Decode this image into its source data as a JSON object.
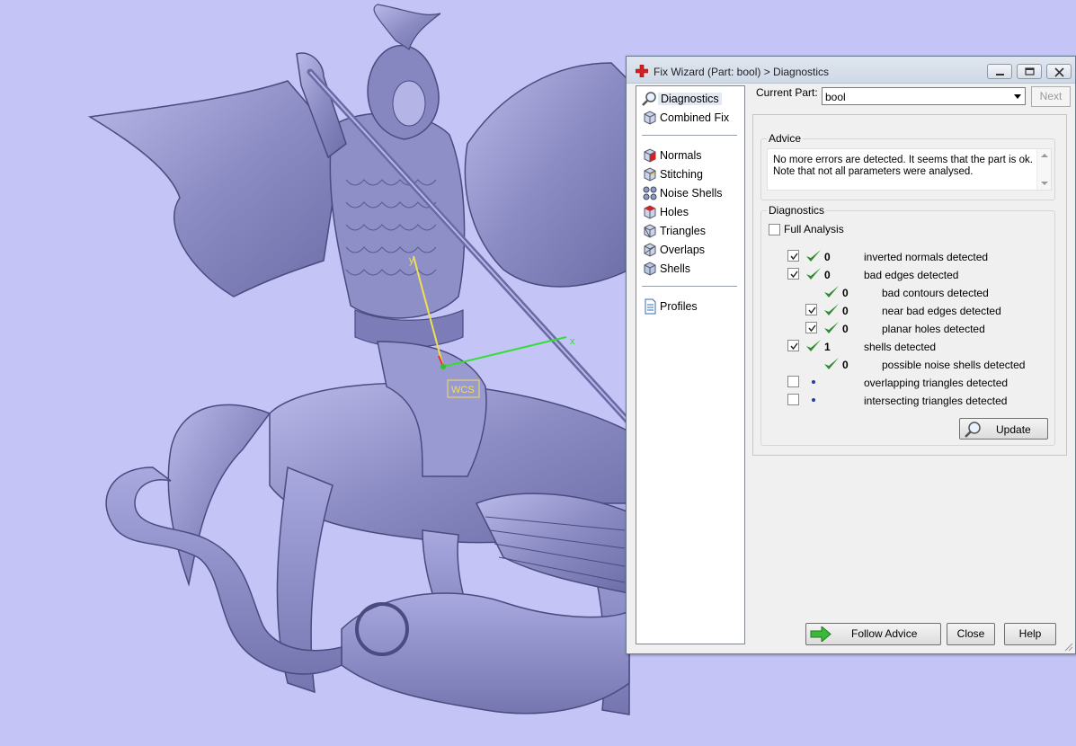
{
  "window": {
    "title": "Fix Wizard (Part: bool) > Diagnostics",
    "accent": "#d61f1f"
  },
  "viewport": {
    "background": "#c4c4f6",
    "axis_x_label": "x",
    "axis_y_label": "y",
    "wcs_label": "WCS"
  },
  "nav": {
    "items": [
      {
        "label": "Diagnostics",
        "icon": "magnifier-icon"
      },
      {
        "label": "Combined Fix",
        "icon": "cube-icon"
      },
      {
        "label": "Normals",
        "icon": "normals-cube-icon"
      },
      {
        "label": "Stitching",
        "icon": "stitching-cube-icon"
      },
      {
        "label": "Noise Shells",
        "icon": "noise-shells-icon"
      },
      {
        "label": "Holes",
        "icon": "holes-cube-icon"
      },
      {
        "label": "Triangles",
        "icon": "triangles-cube-icon"
      },
      {
        "label": "Overlaps",
        "icon": "overlaps-cube-icon"
      },
      {
        "label": "Shells",
        "icon": "shells-cube-icon"
      },
      {
        "label": "Profiles",
        "icon": "document-icon"
      }
    ]
  },
  "current_part": {
    "label": "Current Part:",
    "value": "bool",
    "next_label": "Next"
  },
  "advice": {
    "title": "Advice",
    "text_line1": "No more errors are detected. It seems that the part is ok.",
    "text_line2": "Note that not all parameters were analysed."
  },
  "diagnostics": {
    "title": "Diagnostics",
    "full_analysis_label": "Full Analysis",
    "full_analysis_checked": false,
    "rows": [
      {
        "checked": true,
        "status": "ok",
        "count": "0",
        "text": "inverted normals detected"
      },
      {
        "checked": true,
        "status": "ok",
        "count": "0",
        "text": "bad edges detected"
      },
      {
        "checked": null,
        "status": "ok",
        "count": "0",
        "text": "bad contours detected"
      },
      {
        "checked": true,
        "status": "ok",
        "count": "0",
        "text": "near bad edges detected"
      },
      {
        "checked": true,
        "status": "ok",
        "count": "0",
        "text": "planar holes detected"
      },
      {
        "checked": true,
        "status": "ok",
        "count": "1",
        "text": "shells detected"
      },
      {
        "checked": null,
        "status": "ok",
        "count": "0",
        "text": "possible noise shells detected"
      },
      {
        "checked": false,
        "status": "not-run",
        "count": "",
        "text": "overlapping triangles detected"
      },
      {
        "checked": false,
        "status": "not-run",
        "count": "",
        "text": "intersecting triangles detected"
      }
    ],
    "update_label": "Update"
  },
  "buttons": {
    "follow_advice": "Follow Advice",
    "close": "Close",
    "help": "Help"
  }
}
